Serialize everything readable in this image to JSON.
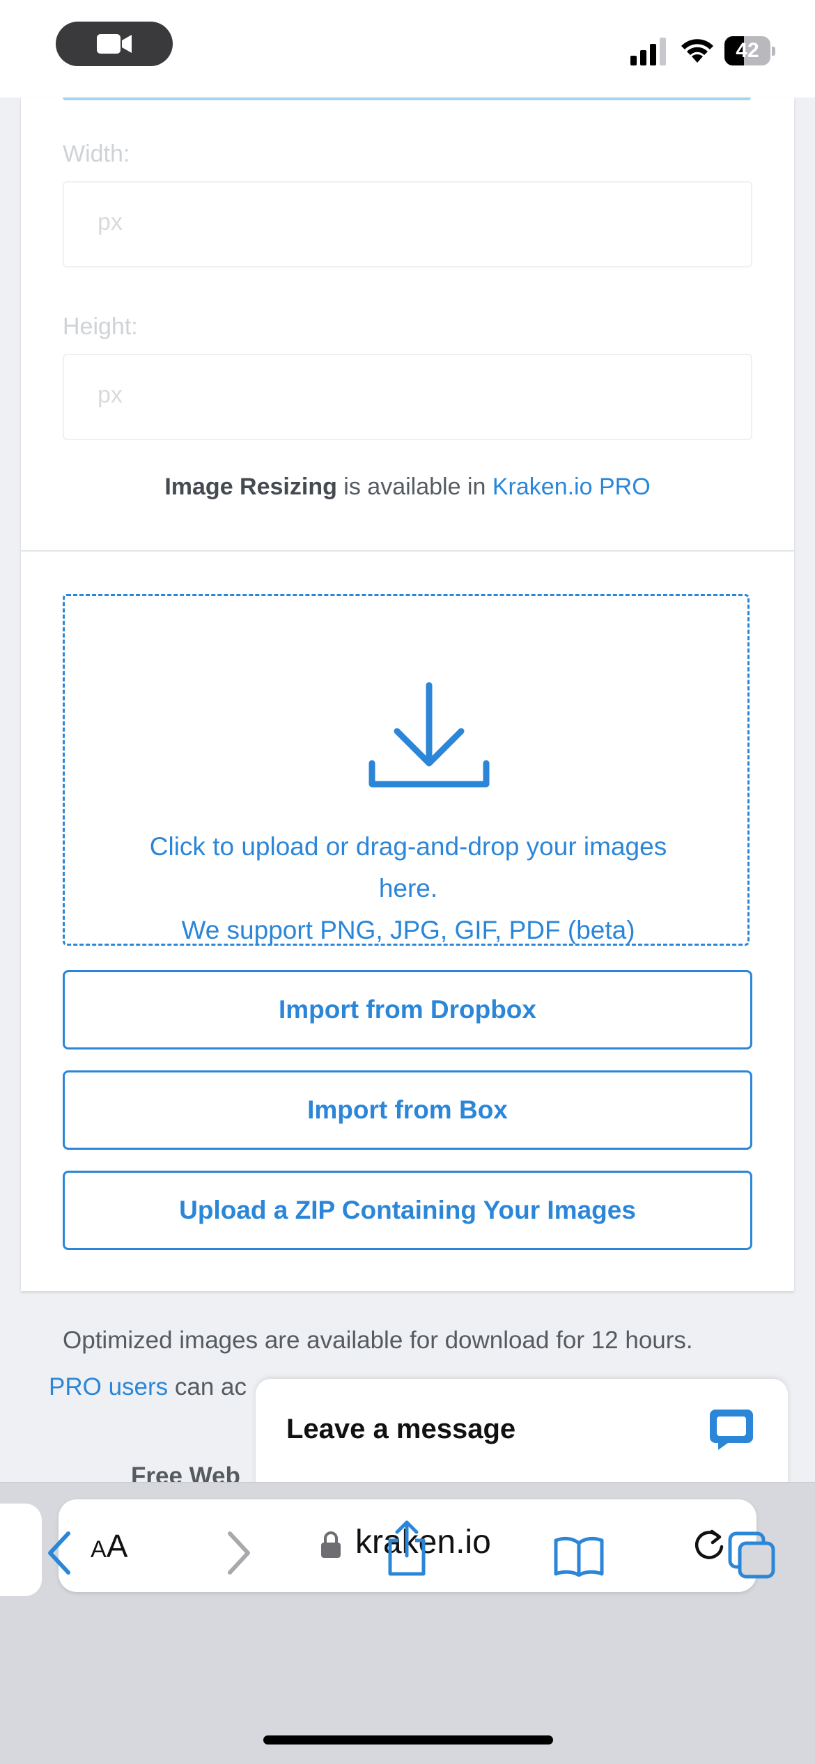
{
  "status_bar": {
    "battery_level": "42",
    "icons": [
      "camera-icon",
      "cellular-signal-icon",
      "wifi-icon",
      "battery-icon"
    ]
  },
  "form": {
    "width_label": "Width:",
    "width_placeholder": "px",
    "height_label": "Height:",
    "height_placeholder": "px",
    "resize_note": {
      "feature": "Image Resizing",
      "middle": " is available in ",
      "link": "Kraken.io PRO"
    }
  },
  "upload": {
    "icon": "download-icon",
    "line1": "Click to upload or drag-and-drop your images",
    "line2": "here.",
    "line3": "We support PNG, JPG, GIF, PDF (beta)",
    "buttons": [
      {
        "label": "Import from Dropbox"
      },
      {
        "label": "Import from Box"
      },
      {
        "label": "Upload a ZIP Containing Your Images"
      }
    ]
  },
  "footer": {
    "note": "Optimized images are available for download for 12 hours.",
    "pro_link": "PRO users",
    "pro_rest": " can ac",
    "free_web_partial": "Free Web"
  },
  "chat": {
    "title": "Leave a message",
    "icon": "chat-bubble-icon"
  },
  "safari": {
    "aa_label_small": "A",
    "aa_label_large": "A",
    "url": "kraken.io",
    "icons": [
      "lock-icon",
      "reload-icon",
      "back-icon",
      "forward-icon",
      "share-icon",
      "bookmarks-icon",
      "tabs-icon"
    ]
  },
  "colors": {
    "accent": "#2b86d8",
    "text_muted": "#555b61",
    "placeholder": "#d8dadd",
    "toolbar_bg": "#d6d8dd"
  }
}
